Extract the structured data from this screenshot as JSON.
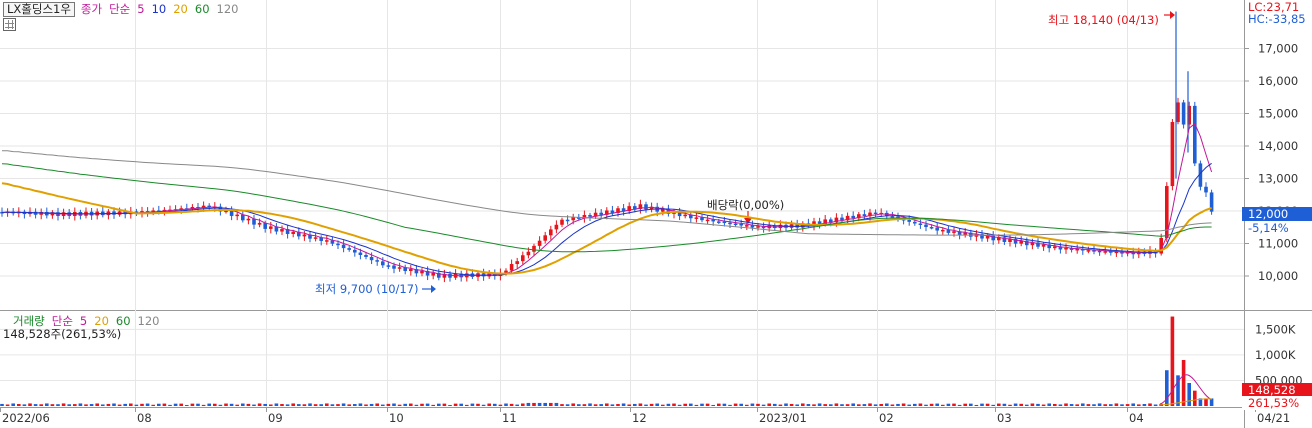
{
  "legend_price": {
    "stock_name": "LX홀딩스1우",
    "price_type": "종가",
    "ma_type": "단순",
    "ma_periods": [
      "5",
      "10",
      "20",
      "60",
      "120"
    ],
    "ma_colors": [
      "#c0199a",
      "#1a33c8",
      "#e0a000",
      "#1a8a2a",
      "#888888"
    ]
  },
  "legend_volume": {
    "title": "거래량",
    "ma_type": "단순",
    "ma_periods": [
      "5",
      "20",
      "60",
      "120"
    ],
    "ma_colors": [
      "#c0199a",
      "#e0a000",
      "#1a8a2a",
      "#888888"
    ],
    "current_text": "148,528주(261,53%)"
  },
  "top_right": {
    "lc": "LC:23,71",
    "hc": "HC:-33,85"
  },
  "annotations": {
    "high": "최고 18,140 (04/13)",
    "low": "최저 9,700 (10/17)",
    "dividend": "배당락(0,00%)"
  },
  "current_price": {
    "price": "12,000",
    "change": "-5,14%"
  },
  "current_volume": {
    "value": "148,528",
    "ratio": "261,53%"
  },
  "colors": {
    "up": "#e8141b",
    "down": "#1f5fd6",
    "grid": "#e6e6e6"
  },
  "chart_data": [
    {
      "type": "candlestick",
      "title": "LX홀딩스1우",
      "x_tick_labels": [
        "2022/06",
        "08",
        "09",
        "10",
        "11",
        "12",
        "2023/01",
        "02",
        "03",
        "04",
        "04/21"
      ],
      "y_tick_labels": [
        "10,000",
        "11,000",
        "12,000",
        "13,000",
        "14,000",
        "15,000",
        "16,000",
        "17,000"
      ],
      "ylim": [
        9300,
        18400
      ],
      "high": {
        "value": 18140,
        "date": "04/13"
      },
      "low": {
        "value": 9700,
        "date": "10/17"
      },
      "last_close": 12000,
      "change_pct": -5.14,
      "series": [
        {
          "name": "5",
          "last": 12600
        },
        {
          "name": "10",
          "last": 12500
        },
        {
          "name": "20",
          "last": 11550
        },
        {
          "name": "60",
          "last": 11350
        },
        {
          "name": "120",
          "last": 11250
        }
      ],
      "points": [
        {
          "x": "2022/06",
          "close": 11970
        },
        {
          "x": "2022/07",
          "close": 11900
        },
        {
          "x": "2022/08",
          "close": 12150
        },
        {
          "x": "2022/09",
          "close": 11050
        },
        {
          "x": "2022/10",
          "close": 10000
        },
        {
          "x": "2022/11",
          "close": 10400
        },
        {
          "x": "2022/11 mid",
          "close": 11850
        },
        {
          "x": "2022/12",
          "close": 12100
        },
        {
          "x": "2023/01",
          "close": 11550
        },
        {
          "x": "2023/02",
          "close": 11950
        },
        {
          "x": "2023/03",
          "close": 11100
        },
        {
          "x": "2023/04 early",
          "close": 10750
        },
        {
          "x": "2023/04/13",
          "close": 16000
        },
        {
          "x": "2023/04/21",
          "close": 12000
        }
      ]
    },
    {
      "type": "bar",
      "title": "거래량",
      "y_tick_labels": [
        "500,000",
        "1,000K",
        "1,500K"
      ],
      "ylim": [
        0,
        1800000
      ],
      "last_volume": 148528,
      "last_ratio_pct": 261.53,
      "peak_volume": 1750000
    }
  ]
}
